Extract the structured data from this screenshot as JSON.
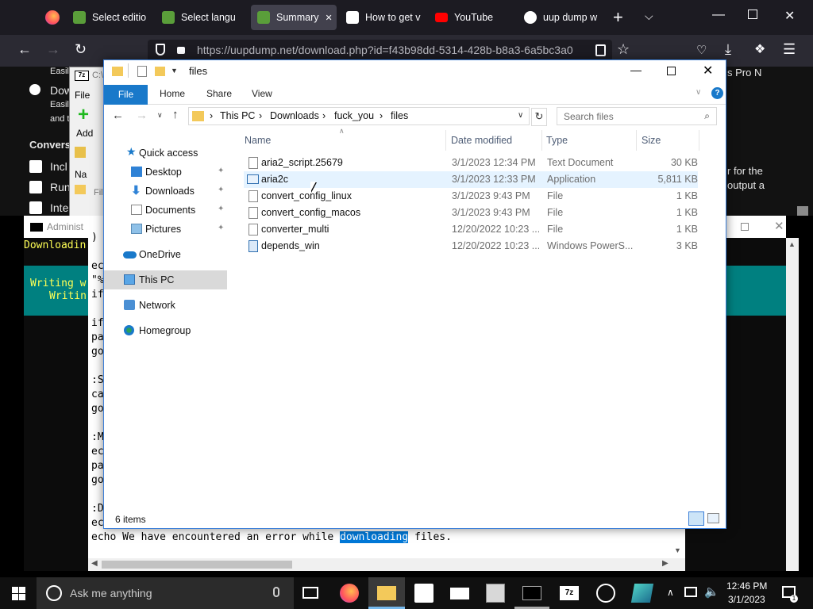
{
  "firefox": {
    "tabs": [
      {
        "label": "Select editio",
        "color": "#5a9e3a"
      },
      {
        "label": "Select langu",
        "color": "#5a9e3a"
      },
      {
        "label": "Summary",
        "color": "#5a9e3a"
      },
      {
        "label": "How to get v",
        "color": "#ffffff"
      },
      {
        "label": "YouTube",
        "color": "#ff0000"
      },
      {
        "label": "uup dump w",
        "color": "#ffffff"
      }
    ],
    "close_tab": "✕",
    "new_tab": "+",
    "url": "https://uupdump.net/download.php?id=f43b98dd-5314-428b-b8a3-6a5bc3a0"
  },
  "webpage": {
    "left_texts": [
      "Easil",
      "Dow",
      "Easil",
      "and t"
    ],
    "conversion_heading": "Convers",
    "options": [
      "Incl",
      "Run",
      "Inte"
    ],
    "right_texts": [
      "s Pro N",
      "r for the",
      "output a"
    ]
  },
  "zip": {
    "title_prefix": "C:\\",
    "file_menu": "File",
    "add_label": "Add",
    "name_col": "Na",
    "file_col": "Fil"
  },
  "cmd": {
    "title": "Administ",
    "downloading": "Downloadin",
    "writing1": "Writing w",
    "writing2": "Writin"
  },
  "notepad": {
    "lines": [
      ")",
      "",
      "ec",
      "\"%",
      "if",
      "",
      "if",
      "pa",
      "go",
      "",
      ":S",
      "ca",
      "go",
      "",
      ":M",
      "ec",
      "pa",
      "go",
      "",
      ":D",
      "ec"
    ],
    "last_line_before": "echo We have encountered an error while ",
    "last_line_highlight": "downloading",
    "last_line_after": " files."
  },
  "explorer": {
    "title": "files",
    "ribbon_tabs": [
      "File",
      "Home",
      "Share",
      "View"
    ],
    "breadcrumb": [
      "This PC",
      "Downloads",
      "fuck_you",
      "files"
    ],
    "search_placeholder": "Search files",
    "nav": [
      {
        "label": "Quick access",
        "icon": "star-icon",
        "pin": false
      },
      {
        "label": "Desktop",
        "icon": "desktop-icon",
        "pin": true
      },
      {
        "label": "Downloads",
        "icon": "download-icon",
        "pin": true
      },
      {
        "label": "Documents",
        "icon": "documents-icon",
        "pin": true
      },
      {
        "label": "Pictures",
        "icon": "pictures-icon",
        "pin": true
      },
      {
        "label": "OneDrive",
        "icon": "cloud-icon",
        "pin": false
      },
      {
        "label": "This PC",
        "icon": "computer-icon",
        "pin": false
      },
      {
        "label": "Network",
        "icon": "network-icon",
        "pin": false
      },
      {
        "label": "Homegroup",
        "icon": "homegroup-icon",
        "pin": false
      }
    ],
    "columns": [
      "Name",
      "Date modified",
      "Type",
      "Size"
    ],
    "files": [
      {
        "name": "aria2_script.25679",
        "date": "3/1/2023 12:34 PM",
        "type": "Text Document",
        "size": "30 KB"
      },
      {
        "name": "aria2c",
        "date": "3/1/2023 12:33 PM",
        "type": "Application",
        "size": "5,811 KB"
      },
      {
        "name": "convert_config_linux",
        "date": "3/1/2023 9:43 PM",
        "type": "File",
        "size": "1 KB"
      },
      {
        "name": "convert_config_macos",
        "date": "3/1/2023 9:43 PM",
        "type": "File",
        "size": "1 KB"
      },
      {
        "name": "converter_multi",
        "date": "12/20/2022 10:23 ...",
        "type": "File",
        "size": "1 KB"
      },
      {
        "name": "depends_win",
        "date": "12/20/2022 10:23 ...",
        "type": "Windows PowerS...",
        "size": "3 KB"
      }
    ],
    "status": "6 items"
  },
  "taskbar": {
    "search_placeholder": "Ask me anything",
    "time": "12:46 PM",
    "date": "3/1/2023"
  }
}
